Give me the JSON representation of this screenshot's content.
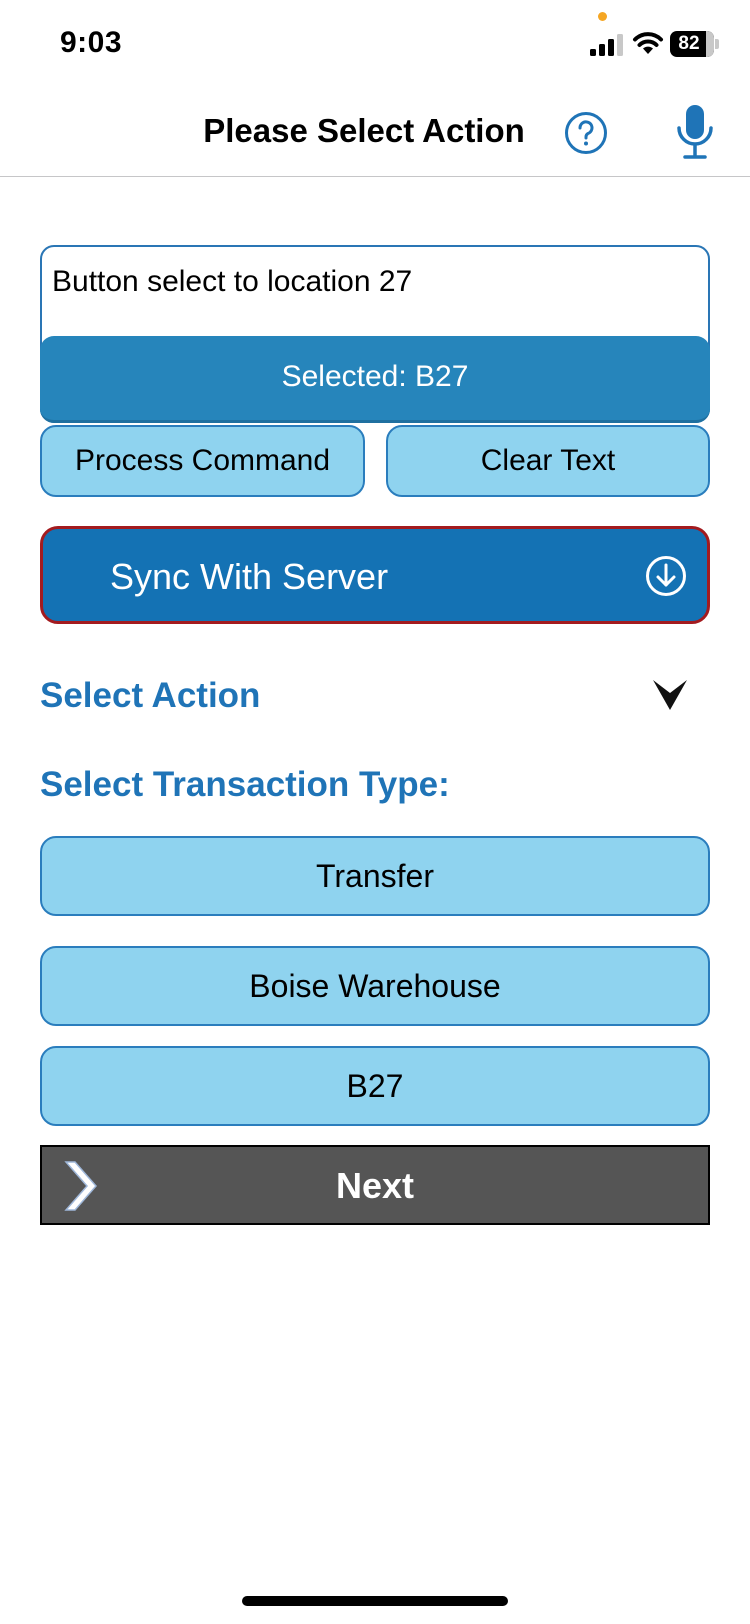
{
  "status_bar": {
    "time": "9:03",
    "battery_level": "82",
    "battery_percent": 82,
    "privacy_indicator_color": "#f5a623",
    "icons": [
      "signal-icon",
      "wifi-icon",
      "battery-icon"
    ]
  },
  "nav": {
    "title": "Please Select Action",
    "icons": [
      "help-icon",
      "microphone-icon"
    ]
  },
  "command": {
    "text": "Button select to location 27",
    "selected": "Selected: B27"
  },
  "actions": {
    "process_label": "Process Command",
    "clear_label": "Clear Text"
  },
  "sync": {
    "label": "Sync With Server",
    "icon": "download-circle-icon"
  },
  "select_action": {
    "label": "Select Action",
    "icon": "chevron-down-icon"
  },
  "transaction": {
    "heading": "Select Transaction Type:",
    "options": [
      {
        "label": "Transfer"
      },
      {
        "label": "Boise Warehouse"
      },
      {
        "label": "B27"
      }
    ]
  },
  "next": {
    "label": "Next",
    "icon": "chevron-right-icon"
  },
  "colors": {
    "accent_blue": "#1f74b7",
    "light_button": "#8fd3ef",
    "sync_fill": "#1472b4",
    "sync_border": "#a31b1f",
    "selected_bar": "#2685bb",
    "next_fill": "#555555"
  }
}
